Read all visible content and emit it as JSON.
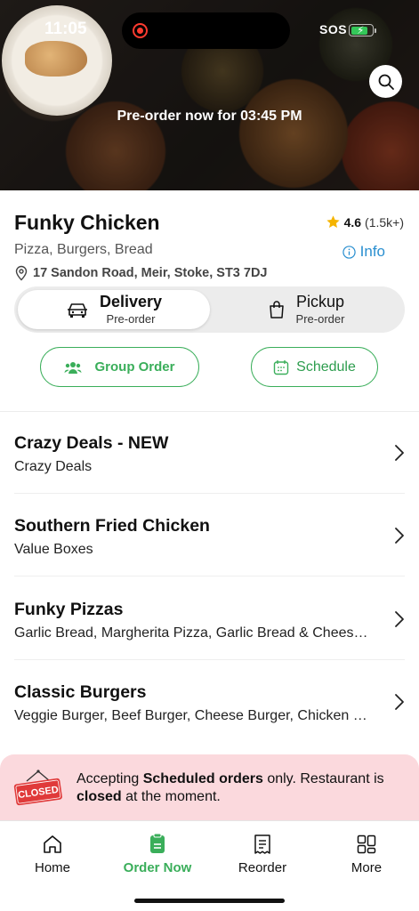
{
  "status_bar": {
    "time": "11:05",
    "sos": "SOS"
  },
  "hero": {
    "preorder_text": "Pre-order now for 03:45 PM"
  },
  "restaurant": {
    "name": "Funky Chicken",
    "rating": "4.6",
    "rating_count": "(1.5k+)",
    "cuisines": "Pizza, Burgers, Bread",
    "info_label": "Info",
    "address": "17 Sandon Road, Meir, Stoke, ST3 7DJ"
  },
  "order_mode": {
    "delivery": {
      "title": "Delivery",
      "sub": "Pre-order"
    },
    "pickup": {
      "title": "Pickup",
      "sub": "Pre-order"
    },
    "selected": "delivery"
  },
  "actions": {
    "group_order": "Group Order",
    "schedule": "Schedule"
  },
  "categories": [
    {
      "title": "Crazy Deals - NEW",
      "sub": "Crazy Deals"
    },
    {
      "title": "Southern Fried Chicken",
      "sub": "Value Boxes"
    },
    {
      "title": "Funky Pizzas",
      "sub": "Garlic Bread, Margherita Pizza, Garlic Bread & Cheese Pizza"
    },
    {
      "title": "Classic Burgers",
      "sub": "Veggie Burger, Beef Burger, Cheese Burger, Chicken Fillet Burger"
    }
  ],
  "closed_notice": {
    "sign": "CLOSED",
    "p1": "Accepting ",
    "b1": "Scheduled orders",
    "p2": " only. Restaurant is ",
    "b2": "closed",
    "p3": " at the moment."
  },
  "tabs": [
    {
      "label": "Home",
      "icon": "home-icon"
    },
    {
      "label": "Order Now",
      "icon": "order-icon"
    },
    {
      "label": "Reorder",
      "icon": "receipt-icon"
    },
    {
      "label": "More",
      "icon": "grid-icon"
    }
  ],
  "colors": {
    "accent": "#3aae5a",
    "info": "#2a8fd0",
    "star": "#f5b400",
    "closed_bg": "#fbd9dd",
    "closed_sign": "#e03a3a"
  }
}
